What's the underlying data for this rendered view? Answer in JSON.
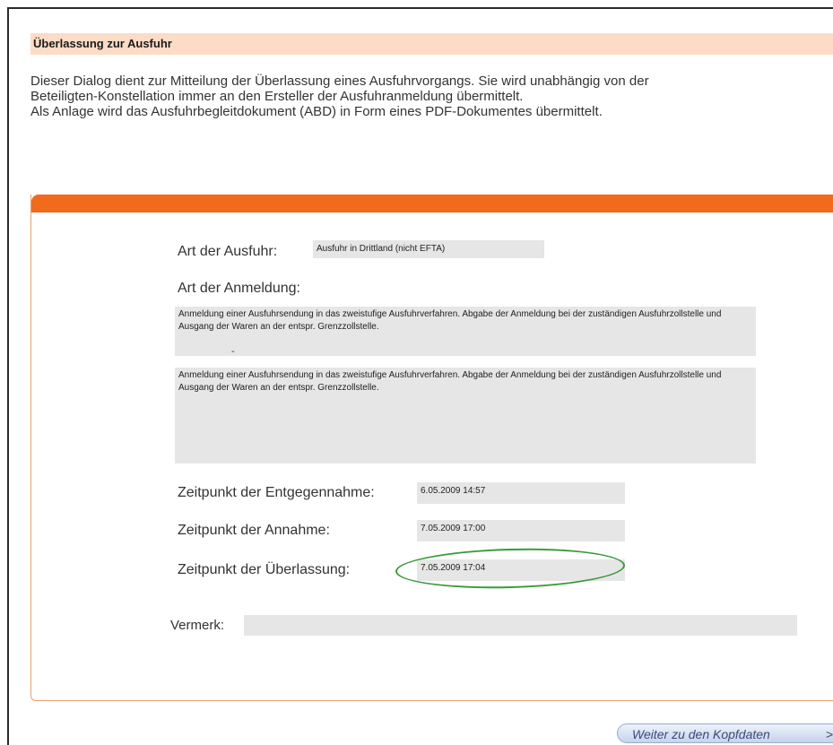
{
  "header": {
    "title": "Überlassung zur  Ausfuhr"
  },
  "intro": {
    "line1": "Dieser Dialog dient zur Mitteilung der Überlassung eines Ausfuhrvorgangs. Sie wird unabhängig von der",
    "line2": "Beteiligten-Konstellation immer an den Ersteller der Ausfuhranmeldung übermittelt.",
    "line3": "Als Anlage wird das Ausfuhrbegleitdokument (ABD) in Form eines PDF-Dokumentes übermittelt."
  },
  "form": {
    "art_ausfuhr_label": "Art der Ausfuhr:",
    "art_ausfuhr_value": "Ausfuhr in Drittland (nicht EFTA)",
    "art_anmeldung_label": "Art der Anmeldung:",
    "art_anmeldung_value": "Anmeldung einer Ausfuhrsendung in das zweistufige Ausfuhrverfahren. Abgabe der Anmeldung bei der zuständigen Ausfuhrzollstelle und Ausgang der Waren an der entspr. Grenzzollstelle.",
    "art_anmeldung_separator": "-",
    "anmeldung_detail": "Anmeldung einer Ausfuhrsendung in das zweistufige Ausfuhrverfahren. Abgabe der Anmeldung bei der zuständigen Ausfuhrzollstelle und Ausgang der Waren an der entspr. Grenzzollstelle.",
    "entgegennahme_label": "Zeitpunkt der Entgegennahme:",
    "entgegennahme_value": "6.05.2009 14:57",
    "annahme_label": "Zeitpunkt der Annahme:",
    "annahme_value": "7.05.2009 17:00",
    "ueberlassung_label": "Zeitpunkt der Überlassung:",
    "ueberlassung_value": "7.05.2009 17:04",
    "vermerk_label": "Vermerk:",
    "vermerk_value": ""
  },
  "footer": {
    "next_label": "Weiter zu den Kopfdaten",
    "next_arrow": ">"
  },
  "colors": {
    "accent": "#f26a1b",
    "header_bg": "#fcdcc6",
    "highlight": "#3a9a3a"
  }
}
